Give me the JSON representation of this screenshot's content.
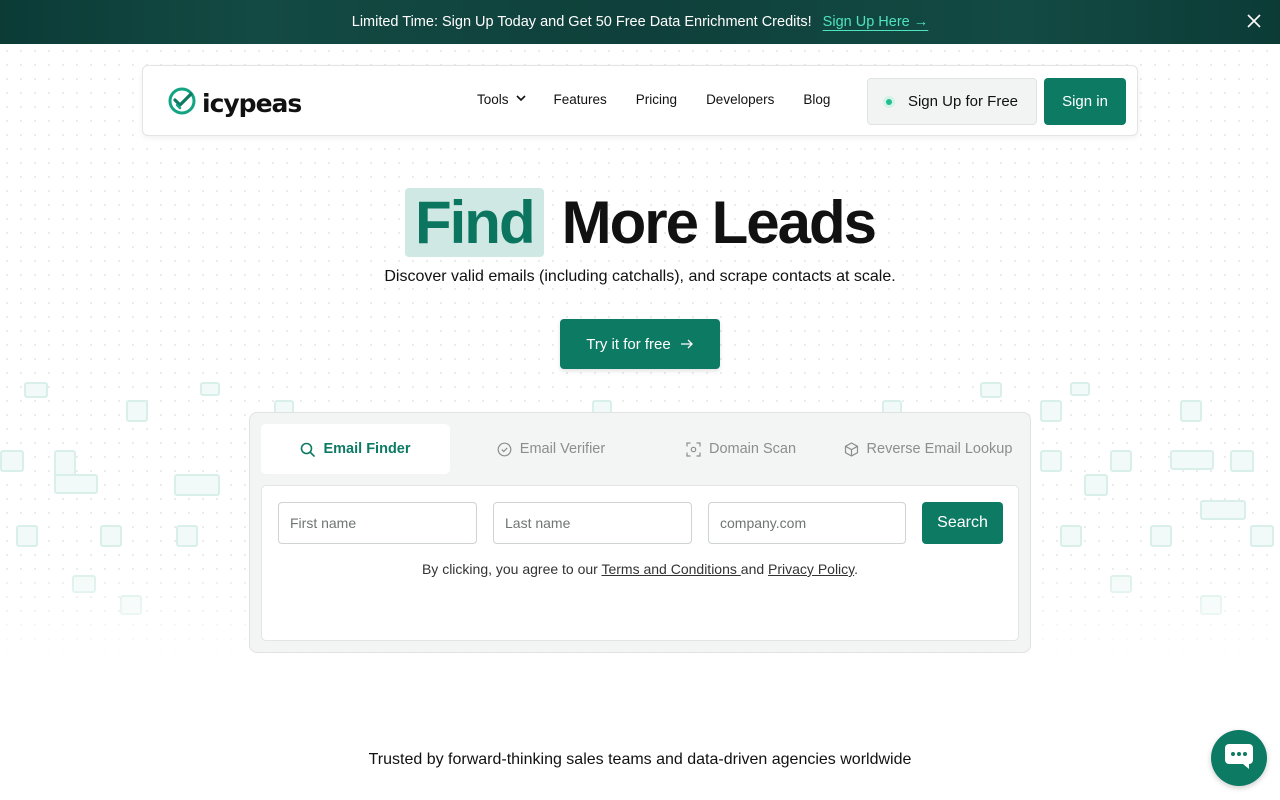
{
  "announcement": {
    "text": "Limited Time: Sign Up Today and Get 50 Free Data Enrichment Credits!",
    "link_label": "Sign Up Here →"
  },
  "nav": {
    "logo_text": "icypeas",
    "links": {
      "tools": "Tools",
      "features": "Features",
      "pricing": "Pricing",
      "developers": "Developers",
      "blog": "Blog"
    },
    "signup_label": "Sign Up for Free",
    "signin_label": "Sign in"
  },
  "hero": {
    "title_highlight": "Find",
    "title_rest": "More Leads",
    "subtitle": "Discover valid emails (including catchalls), and scrape contacts at scale.",
    "cta_label": "Try it for free"
  },
  "tool": {
    "tabs": [
      {
        "label": "Email Finder",
        "icon": "search-icon"
      },
      {
        "label": "Email Verifier",
        "icon": "check-circle-icon"
      },
      {
        "label": "Domain Scan",
        "icon": "scan-icon"
      },
      {
        "label": "Reverse Email Lookup",
        "icon": "cube-icon"
      }
    ],
    "first_name_placeholder": "First name",
    "last_name_placeholder": "Last name",
    "domain_placeholder": "company.com",
    "search_label": "Search",
    "consent_prefix": "By clicking, you agree to our ",
    "terms_label": "Terms and Conditions ",
    "consent_and": "and ",
    "privacy_label": "Privacy Policy",
    "consent_suffix": "."
  },
  "trusted_text": "Trusted by forward-thinking sales teams and data-driven agencies worldwide",
  "colors": {
    "accent": "#0d7a64",
    "banner_link": "#4fe3c1",
    "highlight_bg": "#cfe8e3"
  }
}
